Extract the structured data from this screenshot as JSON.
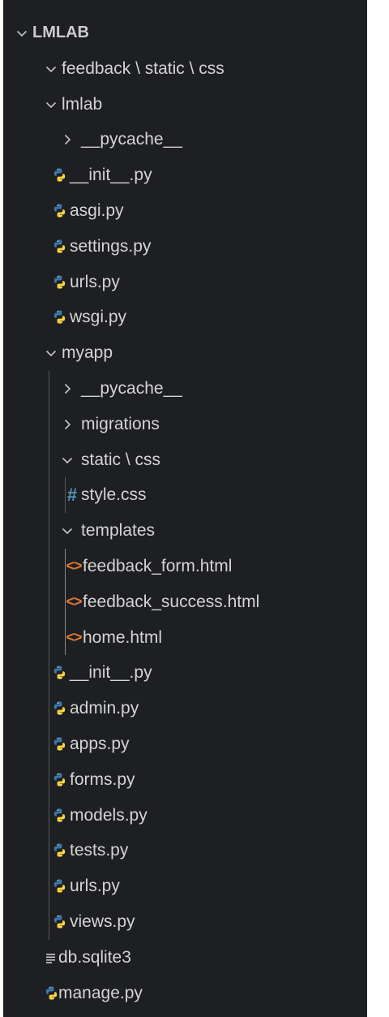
{
  "explorer": {
    "root_label": "LMLAB",
    "items": [
      {
        "id": "root",
        "label": "LMLAB",
        "kind": "folder",
        "expanded": true,
        "depth": 0
      },
      {
        "id": "feedback-static-css",
        "label": "feedback \\ static \\ css",
        "kind": "folder",
        "expanded": true,
        "depth": 1
      },
      {
        "id": "lmlab",
        "label": "lmlab",
        "kind": "folder",
        "expanded": true,
        "depth": 1
      },
      {
        "id": "lmlab-pycache",
        "label": "__pycache__",
        "kind": "folder",
        "expanded": false,
        "depth": 2
      },
      {
        "id": "lmlab-init",
        "label": "__init__.py",
        "kind": "python",
        "depth": 2
      },
      {
        "id": "lmlab-asgi",
        "label": "asgi.py",
        "kind": "python",
        "depth": 2
      },
      {
        "id": "lmlab-settings",
        "label": "settings.py",
        "kind": "python",
        "depth": 2
      },
      {
        "id": "lmlab-urls",
        "label": "urls.py",
        "kind": "python",
        "depth": 2
      },
      {
        "id": "lmlab-wsgi",
        "label": "wsgi.py",
        "kind": "python",
        "depth": 2
      },
      {
        "id": "myapp",
        "label": "myapp",
        "kind": "folder",
        "expanded": true,
        "depth": 1
      },
      {
        "id": "myapp-pycache",
        "label": "__pycache__",
        "kind": "folder",
        "expanded": false,
        "depth": 2
      },
      {
        "id": "myapp-migrations",
        "label": "migrations",
        "kind": "folder",
        "expanded": false,
        "depth": 2
      },
      {
        "id": "myapp-static-css",
        "label": "static \\ css",
        "kind": "folder",
        "expanded": true,
        "depth": 2
      },
      {
        "id": "style-css",
        "label": "style.css",
        "kind": "css",
        "depth": 3
      },
      {
        "id": "templates",
        "label": "templates",
        "kind": "folder",
        "expanded": true,
        "depth": 2
      },
      {
        "id": "feedback-form",
        "label": "feedback_form.html",
        "kind": "html",
        "depth": 3
      },
      {
        "id": "feedback-success",
        "label": "feedback_success.html",
        "kind": "html",
        "depth": 3
      },
      {
        "id": "home-html",
        "label": "home.html",
        "kind": "html",
        "depth": 3
      },
      {
        "id": "myapp-init",
        "label": "__init__.py",
        "kind": "python",
        "depth": 2
      },
      {
        "id": "myapp-admin",
        "label": "admin.py",
        "kind": "python",
        "depth": 2
      },
      {
        "id": "myapp-apps",
        "label": "apps.py",
        "kind": "python",
        "depth": 2
      },
      {
        "id": "myapp-forms",
        "label": "forms.py",
        "kind": "python",
        "depth": 2
      },
      {
        "id": "myapp-models",
        "label": "models.py",
        "kind": "python",
        "depth": 2
      },
      {
        "id": "myapp-tests",
        "label": "tests.py",
        "kind": "python",
        "depth": 2
      },
      {
        "id": "myapp-urls",
        "label": "urls.py",
        "kind": "python",
        "depth": 2
      },
      {
        "id": "myapp-views",
        "label": "views.py",
        "kind": "python",
        "depth": 2
      },
      {
        "id": "db-sqlite3",
        "label": "db.sqlite3",
        "kind": "database",
        "depth": 1
      },
      {
        "id": "manage-py",
        "label": "manage.py",
        "kind": "python",
        "depth": 1
      }
    ]
  },
  "icons": {
    "python": "python-icon",
    "css": "css-hash-icon",
    "html": "html-brackets-icon",
    "database": "lines-file-icon",
    "chevron_open": "chevron-down-icon",
    "chevron_closed": "chevron-right-icon"
  },
  "colors": {
    "background": "#1e1f22",
    "text": "#d4d4d4",
    "python_blue": "#3c78aa",
    "python_yellow": "#ffd43b",
    "css_icon": "#519aba",
    "html_icon": "#e37933",
    "indent_guide": "#585858"
  }
}
